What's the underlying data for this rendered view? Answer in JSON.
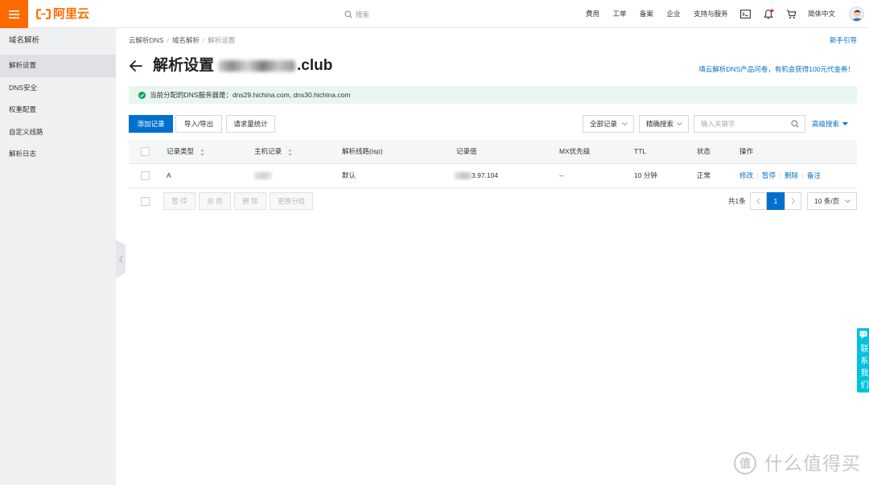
{
  "header": {
    "logo_text": "阿里云",
    "search_placeholder": "搜索",
    "nav": [
      "费用",
      "工单",
      "备案",
      "企业",
      "支持与服务"
    ],
    "language": "简体中文"
  },
  "sidebar": {
    "title": "域名解析",
    "items": [
      {
        "label": "解析设置",
        "active": true
      },
      {
        "label": "DNS安全",
        "active": false
      },
      {
        "label": "权重配置",
        "active": false
      },
      {
        "label": "自定义线路",
        "active": false
      },
      {
        "label": "解析日志",
        "active": false
      }
    ]
  },
  "breadcrumb": {
    "items": [
      "云解析DNS",
      "域名解析",
      "解析设置"
    ],
    "separator": "/"
  },
  "guide_link": "新手引导",
  "page": {
    "title": "解析设置",
    "domain_suffix": ".club",
    "promo": "填云解析DNS产品问卷，有机会获得100元代金券！"
  },
  "alert": {
    "text": "当前分配的DNS服务器是：dns29.hichina.com, dns30.hichina.com"
  },
  "toolbar": {
    "add_record": "添加记录",
    "import_export": "导入/导出",
    "request_stats": "请求量统计",
    "record_filter": "全部记录",
    "search_mode": "精确搜索",
    "search_placeholder": "输入关键字",
    "advanced_search": "高级搜索"
  },
  "table": {
    "columns": [
      "记录类型",
      "主机记录",
      "解析线路(isp)",
      "记录值",
      "MX优先级",
      "TTL",
      "状态",
      "操作"
    ],
    "rows": [
      {
        "type": "A",
        "line": "默认",
        "value": "3.97.104",
        "mx_priority": "--",
        "ttl": "10 分钟",
        "status": "正常",
        "actions": [
          "修改",
          "暂停",
          "删除",
          "备注"
        ]
      }
    ]
  },
  "bulk_actions": [
    "暂 停",
    "启 用",
    "删 除",
    "更换分组"
  ],
  "pagination": {
    "total": "共1条",
    "current_page": "1",
    "page_size": "10 条/页"
  },
  "contact_tab": "联系我们",
  "watermark": {
    "logo": "值",
    "text": "什么值得买"
  },
  "icons": [
    "hamburger-icon",
    "aliyun-bracket-icon",
    "search-icon",
    "terminal-icon",
    "bell-icon",
    "cart-icon",
    "back-arrow-icon",
    "check-circle-icon",
    "chevron-down-icon",
    "sort-icon",
    "caret-down-icon",
    "chevron-left-icon",
    "chevron-right-icon",
    "chat-icon"
  ],
  "colors": {
    "brand_orange": "#ff6a00",
    "link_blue": "#0070cc",
    "status_green": "#00a854",
    "contact_cyan": "#00c1de",
    "alert_bg": "#e8f6ef"
  }
}
